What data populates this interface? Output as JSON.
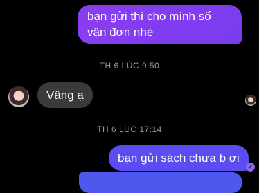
{
  "messages": {
    "outgoing_1": "bạn gửi thì cho mình số vận đơn nhé",
    "timestamp_1": "TH 6 LÚC 9:50",
    "incoming_1": "Vâng ạ",
    "timestamp_2": "TH 6 LÚC 17:14",
    "outgoing_2": "bạn gửi sách chưa b ơi"
  },
  "icons": {
    "seen_indicator": "check-icon"
  },
  "colors": {
    "outgoing_bubble": "#7a3cf0",
    "outgoing_bubble_2": "#5b4df2",
    "incoming_bubble": "#3a3a3c",
    "background": "#000000",
    "timestamp_text": "#9a9a9a"
  }
}
